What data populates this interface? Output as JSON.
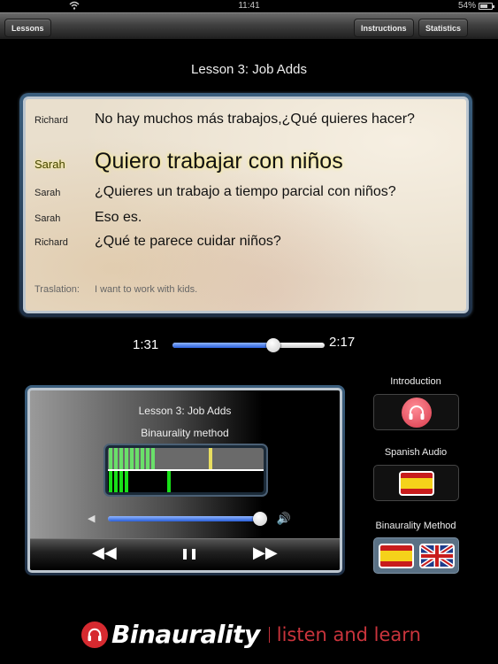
{
  "status_bar": {
    "wifi_icon": "wifi-icon",
    "time": "11:41",
    "battery_percent": "54%",
    "battery_level": 0.54
  },
  "toolbar": {
    "lessons_label": "Lessons",
    "instructions_label": "Instructions",
    "statistics_label": "Statistics"
  },
  "lesson_title": "Lesson 3: Job Adds",
  "transcript": {
    "lines": [
      {
        "speaker": "Richard",
        "text": "No hay muchos más trabajos,¿Qué quieres hacer?",
        "active": false
      },
      {
        "speaker": "Sarah",
        "text": "Quiero trabajar con niños",
        "active": true
      },
      {
        "speaker": "Sarah",
        "text": "¿Quieres un trabajo a tiempo parcial con niños?",
        "active": false
      },
      {
        "speaker": "Sarah",
        "text": "Eso es.",
        "active": false
      },
      {
        "speaker": "Richard",
        "text": "¿Qué te parece cuidar niños?",
        "active": false
      }
    ],
    "translation_label": "Traslation:",
    "translation_text": "I want to work with kids."
  },
  "progress": {
    "current_time": "1:31",
    "total_time": "2:17",
    "fraction": 0.664
  },
  "player": {
    "title": "Lesson 3: Job Adds",
    "method": "Binaurality method",
    "meter": {
      "top_bar_count": 9,
      "top_peak": 0.65,
      "bottom_bar_count": 4,
      "bottom_peak": 0.38
    },
    "volume": 1.0,
    "volume_low_icon": "speaker-low-icon",
    "volume_high_icon": "speaker-high-icon",
    "rewind_icon": "rewind-icon",
    "pause_icon": "pause-icon",
    "forward_icon": "fast-forward-icon"
  },
  "side": {
    "introduction_label": "Introduction",
    "spanish_audio_label": "Spanish Audio",
    "binaurality_label": "Binaurality Method"
  },
  "logo": {
    "name": "Binaurality",
    "tagline": "listen and learn"
  },
  "colors": {
    "accent_blue": "#2a5fd8",
    "brand_red": "#d62a30",
    "meter_green": "#18e018",
    "meter_peak": "#e8de60"
  }
}
